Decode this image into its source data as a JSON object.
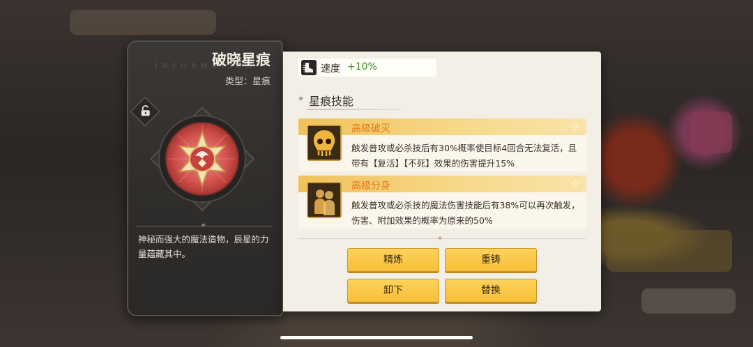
{
  "artifact": {
    "title": "破晓星痕",
    "type_line": "类型：星痕",
    "watermark": "INFORMATION",
    "description": "神秘而强大的魔法造物，辰星的力量蕴藏其中。",
    "lock_icon": "lock-open-icon"
  },
  "stat": {
    "label": "速度",
    "value": "+10%",
    "icon": "boot-icon",
    "value_color": "#3d8b27"
  },
  "section": {
    "title": "星痕技能"
  },
  "skills": [
    {
      "name": "高级破灭",
      "icon": "skull-icon",
      "description": "触发普攻或必杀技后有30%概率使目标4回合无法复活，且带有【复活】【不死】效果的伤害提升15%"
    },
    {
      "name": "高级分身",
      "icon": "clone-icon",
      "description": "触发普攻或必杀技的魔法伤害技能后有38%可以再次触发，伤害、附加效果的概率为原来的50%"
    }
  ],
  "buttons": {
    "refine": "精炼",
    "recast": "重铸",
    "unequip": "卸下",
    "replace": "替换"
  },
  "colors": {
    "accent_gold": "#f8bf38",
    "skill_name": "#e37a1a"
  }
}
